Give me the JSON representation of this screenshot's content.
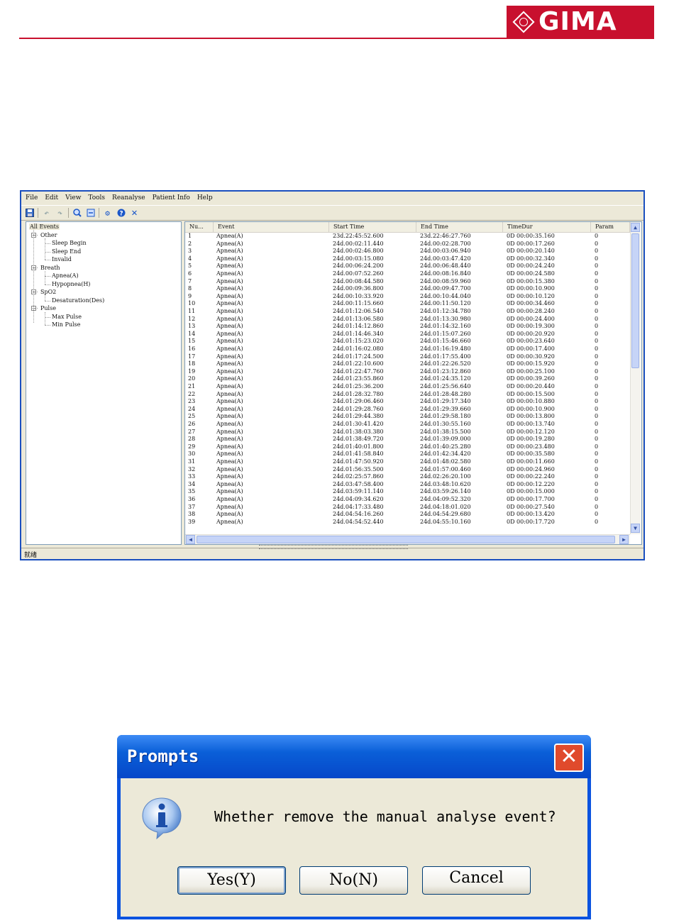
{
  "brand": {
    "logo_text": "GIMA",
    "accent": "#c8102e"
  },
  "window": {
    "menu": [
      "File",
      "Edit",
      "View",
      "Tools",
      "Reanalyse",
      "Patient Info",
      "Help"
    ],
    "toolbar_icons": [
      "save-icon",
      "undo-icon",
      "redo-icon",
      "zoom-in-icon",
      "zoom-out-icon",
      "settings-icon",
      "help-icon",
      "close-icon"
    ],
    "tree": {
      "root": "All Events",
      "groups": [
        {
          "label": "Other",
          "children": [
            "Sleep Begin",
            "Sleep End",
            "Invalid"
          ]
        },
        {
          "label": "Breath",
          "children": [
            "Apnea(A)",
            "Hypopnea(H)"
          ]
        },
        {
          "label": "SpO2",
          "children": [
            "Desaturation(Des)"
          ]
        },
        {
          "label": "Pulse",
          "children": [
            "Max Pulse",
            "Min Pulse"
          ]
        }
      ]
    },
    "columns": [
      "Nu...",
      "Event",
      "Start Time",
      "End Time",
      "TimeDur",
      "Param"
    ],
    "rows": [
      [
        "1",
        "Apnea(A)",
        "23d.22:45:52.600",
        "23d.22:46:27.760",
        "0D 00:00:35.160",
        "0"
      ],
      [
        "2",
        "Apnea(A)",
        "24d.00:02:11.440",
        "24d.00:02:28.700",
        "0D 00:00:17.260",
        "0"
      ],
      [
        "3",
        "Apnea(A)",
        "24d.00:02:46.800",
        "24d.00:03:06.940",
        "0D 00:00:20.140",
        "0"
      ],
      [
        "4",
        "Apnea(A)",
        "24d.00:03:15.080",
        "24d.00:03:47.420",
        "0D 00:00:32.340",
        "0"
      ],
      [
        "5",
        "Apnea(A)",
        "24d.00:06:24.200",
        "24d.00:06:48.440",
        "0D 00:00:24.240",
        "0"
      ],
      [
        "6",
        "Apnea(A)",
        "24d.00:07:52.260",
        "24d.00:08:16.840",
        "0D 00:00:24.580",
        "0"
      ],
      [
        "7",
        "Apnea(A)",
        "24d.00:08:44.580",
        "24d.00:08:59.960",
        "0D 00:00:15.380",
        "0"
      ],
      [
        "8",
        "Apnea(A)",
        "24d.00:09:36.800",
        "24d.00:09:47.700",
        "0D 00:00:10.900",
        "0"
      ],
      [
        "9",
        "Apnea(A)",
        "24d.00:10:33.920",
        "24d.00:10:44.040",
        "0D 00:00:10.120",
        "0"
      ],
      [
        "10",
        "Apnea(A)",
        "24d.00:11:15.660",
        "24d.00:11:50.120",
        "0D 00:00:34.460",
        "0"
      ],
      [
        "11",
        "Apnea(A)",
        "24d.01:12:06.540",
        "24d.01:12:34.780",
        "0D 00:00:28.240",
        "0"
      ],
      [
        "12",
        "Apnea(A)",
        "24d.01:13:06.580",
        "24d.01:13:30.980",
        "0D 00:00:24.400",
        "0"
      ],
      [
        "13",
        "Apnea(A)",
        "24d.01:14:12.860",
        "24d.01:14:32.160",
        "0D 00:00:19.300",
        "0"
      ],
      [
        "14",
        "Apnea(A)",
        "24d.01:14:46.340",
        "24d.01:15:07.260",
        "0D 00:00:20.920",
        "0"
      ],
      [
        "15",
        "Apnea(A)",
        "24d.01:15:23.020",
        "24d.01:15:46.660",
        "0D 00:00:23.640",
        "0"
      ],
      [
        "16",
        "Apnea(A)",
        "24d.01:16:02.080",
        "24d.01:16:19.480",
        "0D 00:00:17.400",
        "0"
      ],
      [
        "17",
        "Apnea(A)",
        "24d.01:17:24.500",
        "24d.01:17:55.400",
        "0D 00:00:30.920",
        "0"
      ],
      [
        "18",
        "Apnea(A)",
        "24d.01:22:10.600",
        "24d.01:22:26.520",
        "0D 00:00:15.920",
        "0"
      ],
      [
        "19",
        "Apnea(A)",
        "24d.01:22:47.760",
        "24d.01:23:12.860",
        "0D 00:00:25.100",
        "0"
      ],
      [
        "20",
        "Apnea(A)",
        "24d.01:23:55.860",
        "24d.01:24:35.120",
        "0D 00:00:39.260",
        "0"
      ],
      [
        "21",
        "Apnea(A)",
        "24d.01:25:36.200",
        "24d.01:25:56.640",
        "0D 00:00:20.440",
        "0"
      ],
      [
        "22",
        "Apnea(A)",
        "24d.01:28:32.780",
        "24d.01:28:48.280",
        "0D 00:00:15.500",
        "0"
      ],
      [
        "23",
        "Apnea(A)",
        "24d.01:29:06.460",
        "24d.01:29:17.340",
        "0D 00:00:10.880",
        "0"
      ],
      [
        "24",
        "Apnea(A)",
        "24d.01:29:28.760",
        "24d.01:29:39.660",
        "0D 00:00:10.900",
        "0"
      ],
      [
        "25",
        "Apnea(A)",
        "24d.01:29:44.380",
        "24d.01:29:58.180",
        "0D 00:00:13.800",
        "0"
      ],
      [
        "26",
        "Apnea(A)",
        "24d.01:30:41.420",
        "24d.01:30:55.160",
        "0D 00:00:13.740",
        "0"
      ],
      [
        "27",
        "Apnea(A)",
        "24d.01:38:03.380",
        "24d.01:38:15.500",
        "0D 00:00:12.120",
        "0"
      ],
      [
        "28",
        "Apnea(A)",
        "24d.01:38:49.720",
        "24d.01:39:09.000",
        "0D 00:00:19.280",
        "0"
      ],
      [
        "29",
        "Apnea(A)",
        "24d.01:40:01.800",
        "24d.01:40:25.280",
        "0D 00:00:23.480",
        "0"
      ],
      [
        "30",
        "Apnea(A)",
        "24d.01:41:58.840",
        "24d.01:42:34.420",
        "0D 00:00:35.580",
        "0"
      ],
      [
        "31",
        "Apnea(A)",
        "24d.01:47:50.920",
        "24d.01:48:02.580",
        "0D 00:00:11.660",
        "0"
      ],
      [
        "32",
        "Apnea(A)",
        "24d.01:56:35.500",
        "24d.01:57:00.460",
        "0D 00:00:24.960",
        "0"
      ],
      [
        "33",
        "Apnea(A)",
        "24d.02:25:57.860",
        "24d.02:26:20.100",
        "0D 00:00:22.240",
        "0"
      ],
      [
        "34",
        "Apnea(A)",
        "24d.03:47:58.400",
        "24d.03:48:10.620",
        "0D 00:00:12.220",
        "0"
      ],
      [
        "35",
        "Apnea(A)",
        "24d.03:59:11.140",
        "24d.03:59:26.140",
        "0D 00:00:15.000",
        "0"
      ],
      [
        "36",
        "Apnea(A)",
        "24d.04:09:34.620",
        "24d.04:09:52.320",
        "0D 00:00:17.700",
        "0"
      ],
      [
        "37",
        "Apnea(A)",
        "24d.04:17:33.480",
        "24d.04:18:01.020",
        "0D 00:00:27.540",
        "0"
      ],
      [
        "38",
        "Apnea(A)",
        "24d.04:54:16.260",
        "24d.04:54:29.680",
        "0D 00:00:13.420",
        "0"
      ],
      [
        "39",
        "Apnea(A)",
        "24d.04:54:52.440",
        "24d.04:55:10.160",
        "0D 00:00:17.720",
        "0"
      ]
    ],
    "status_text": "就绪"
  },
  "dialog": {
    "title": "Prompts",
    "message": "Whether remove the manual analyse event?",
    "buttons": {
      "yes": "Yes(Y)",
      "no": "No(N)",
      "cancel": "Cancel"
    },
    "close_glyph": "✕",
    "icon": "info-icon"
  }
}
